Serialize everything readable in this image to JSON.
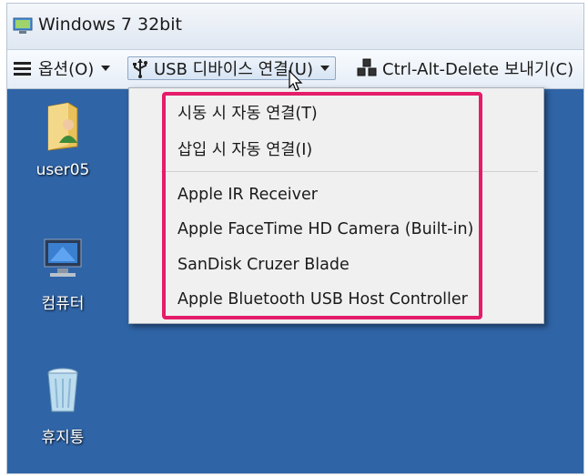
{
  "window": {
    "title": "Windows 7 32bit"
  },
  "toolbar": {
    "options_label": "옵션(O)",
    "usb_label": "USB 디바이스 연결(U)",
    "cad_label": "Ctrl-Alt-Delete 보내기(C)"
  },
  "menu": {
    "auto_connect_startup": "시동 시 자동 연결(T)",
    "auto_connect_insert": "삽입 시 자동 연결(I)",
    "devices": [
      "Apple IR Receiver",
      "Apple FaceTime HD Camera (Built-in)",
      "SanDisk Cruzer Blade",
      "Apple Bluetooth USB Host Controller"
    ]
  },
  "desktop": {
    "icons": [
      {
        "label": "user05",
        "icon": "user-folder-icon"
      },
      {
        "label": "컴퓨터",
        "icon": "computer-icon"
      },
      {
        "label": "휴지통",
        "icon": "recycle-bin-icon"
      }
    ]
  },
  "colors": {
    "desktop": "#2f64a6",
    "highlight": "#e51c6a",
    "menu_bg": "#f0f0f0"
  }
}
